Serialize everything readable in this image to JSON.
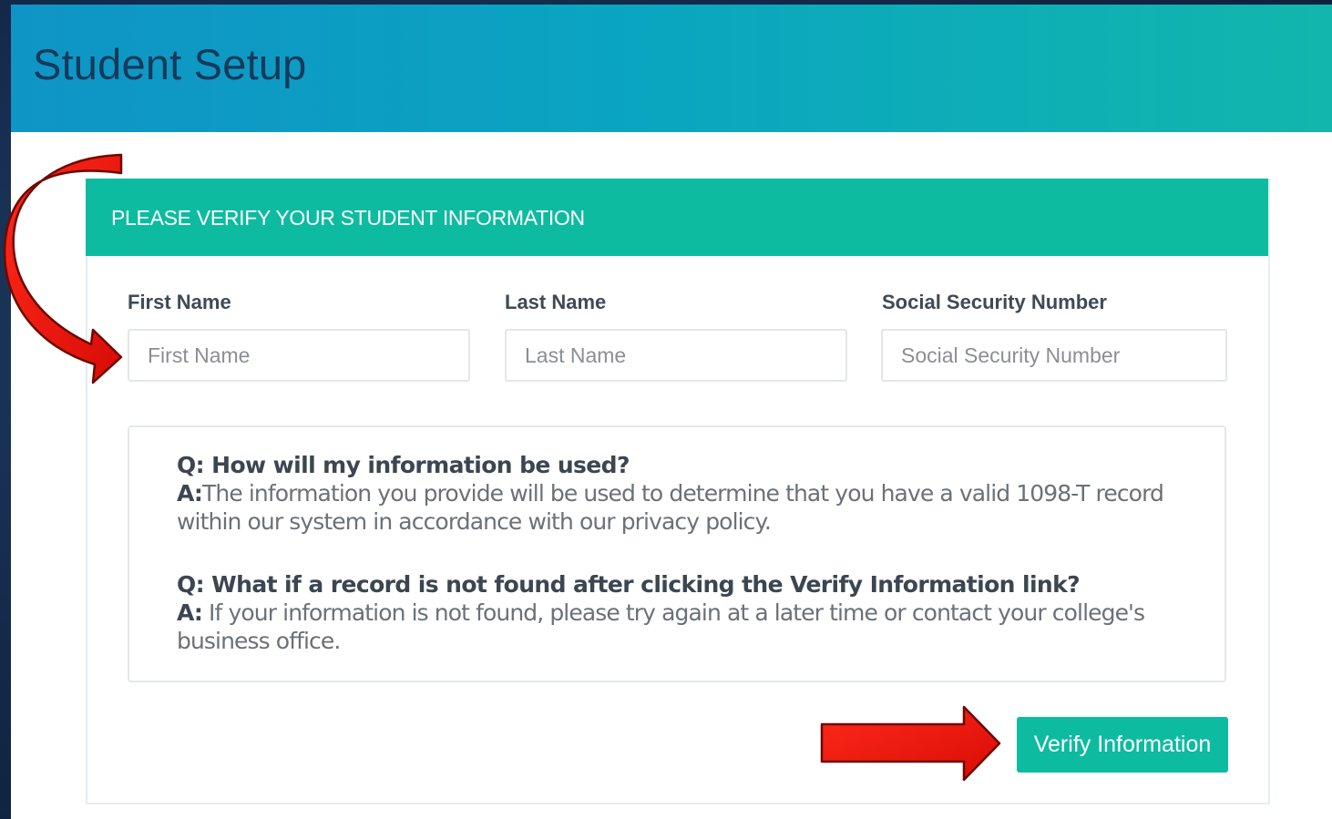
{
  "header": {
    "title": "Student Setup"
  },
  "panel": {
    "heading": "PLEASE VERIFY YOUR STUDENT INFORMATION"
  },
  "form": {
    "first_name": {
      "label": "First Name",
      "placeholder": "First Name",
      "value": ""
    },
    "last_name": {
      "label": "Last Name",
      "placeholder": "Last Name",
      "value": ""
    },
    "ssn": {
      "label": "Social Security Number",
      "placeholder": "Social Security Number",
      "value": ""
    }
  },
  "faq": [
    {
      "question": "Q: How will my information be used?",
      "answer_prefix": "A:",
      "answer": "The information you provide will be used to determine that you have a valid 1098-T record within our system in accordance with our privacy policy."
    },
    {
      "question": "Q: What if a record is not found after clicking the Verify Information link?",
      "answer_prefix": "A:",
      "answer": " If your information is not found, please try again at a later time or contact your college's business office."
    }
  ],
  "actions": {
    "verify_label": "Verify Information"
  },
  "annotations": {
    "arrow_color": "#e8140c",
    "arrow_outline": "#7a0a05",
    "arrows": [
      "curved-arrow-icon",
      "right-arrow-icon"
    ]
  },
  "colors": {
    "header_gradient_start": "#0f94c6",
    "header_gradient_end": "#12b6ac",
    "panel_header": "#0dbba0",
    "button": "#0dbba0",
    "title_text": "#163a5a"
  }
}
